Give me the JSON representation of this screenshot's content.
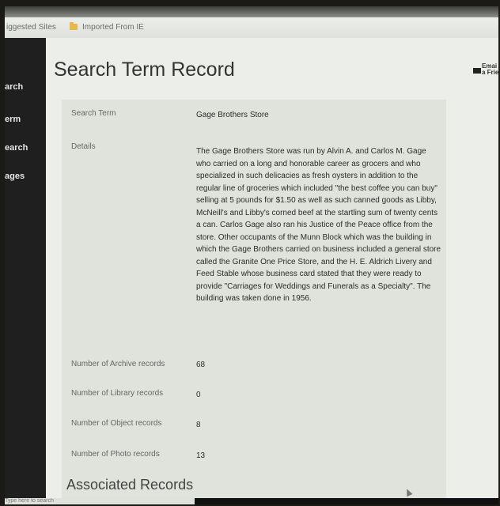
{
  "browser": {
    "bookmarks": [
      {
        "label": "iggested Sites",
        "icon": "page-icon"
      },
      {
        "label": "Imported From IE",
        "icon": "folder-icon"
      }
    ]
  },
  "sidebar": {
    "items": [
      {
        "label": "arch"
      },
      {
        "label": "erm"
      },
      {
        "label": "earch"
      },
      {
        "label": "ages"
      }
    ]
  },
  "header": {
    "title": "Search Term Record",
    "email_lines": [
      "Emai",
      "a Frie"
    ]
  },
  "record": {
    "search_term_label": "Search Term",
    "search_term_value": "Gage Brothers Store",
    "details_label": "Details",
    "details_value": "The Gage Brothers Store was run by Alvin A. and Carlos M. Gage who carried on a long and honorable career as grocers and who specialized in such delicacies as fresh oysters in addition to the regular line of groceries which included \"the best coffee you can buy\" selling at 5 pounds for $1.50 as well as such canned goods as Libby, McNeill's and Libby's corned beef at the startling sum of twenty cents a can. Carlos Gage also ran his Justice of the Peace office from the store. Other occupants of the Munn Block which was the building in which the Gage Brothers carried on business included a general store called the Granite One Price Store, and the H. E. Aldrich Livery and Feed Stable whose business card stated that they were ready to provide \"Carriages for Weddings and Funerals as a Specialty\". The building was taken done in 1956.",
    "counts": [
      {
        "label": "Number of Archive records",
        "value": "68"
      },
      {
        "label": "Number of Library records",
        "value": "0"
      },
      {
        "label": "Number of Object records",
        "value": "8"
      },
      {
        "label": "Number of Photo records",
        "value": "13"
      }
    ]
  },
  "associated": {
    "heading": "Associated Records"
  },
  "taskbar": {
    "search_placeholder": "Type here to search"
  }
}
